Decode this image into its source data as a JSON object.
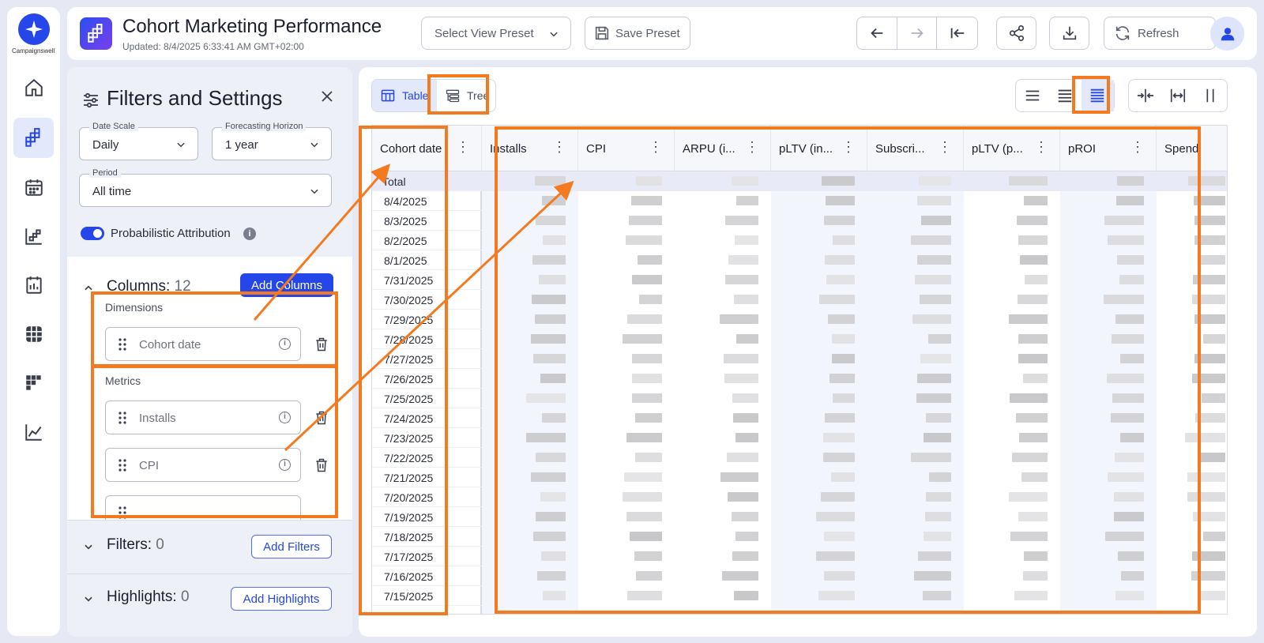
{
  "brand": {
    "name": "Campaignswell",
    "accent": "#2546e8",
    "annotation_color": "#f47a20"
  },
  "header": {
    "title": "Cohort Marketing Performance",
    "updated": "Updated: 8/4/2025 6:33:41 AM GMT+02:00",
    "preset_select_label": "Select View Preset",
    "save_preset_label": "Save Preset",
    "refresh_label": "Refresh"
  },
  "sidebar": {
    "items": [
      {
        "name": "home-icon"
      },
      {
        "name": "cohort-icon",
        "active": true
      },
      {
        "name": "calendar-icon"
      },
      {
        "name": "funnel-icon"
      },
      {
        "name": "report-icon"
      },
      {
        "name": "grid-icon"
      },
      {
        "name": "heatmap-icon"
      },
      {
        "name": "chart-icon"
      }
    ]
  },
  "filters_panel": {
    "title": "Filters and Settings",
    "date_scale": {
      "label": "Date Scale",
      "value": "Daily"
    },
    "forecasting_horizon": {
      "label": "Forecasting Horizon",
      "value": "1 year"
    },
    "period": {
      "label": "Period",
      "value": "All time"
    },
    "probabilistic_attribution": {
      "label": "Probabilistic Attribution",
      "enabled": true
    },
    "columns": {
      "title": "Columns:",
      "count": "12",
      "add_label": "Add Columns",
      "dimensions_label": "Dimensions",
      "dimensions": [
        "Cohort date"
      ],
      "metrics_label": "Metrics",
      "metrics": [
        "Installs",
        "CPI"
      ]
    },
    "filters": {
      "title": "Filters:",
      "count": "0",
      "add_label": "Add Filters"
    },
    "highlights": {
      "title": "Highlights:",
      "count": "0",
      "add_label": "Add Highlights"
    }
  },
  "view": {
    "tabs": [
      "Table",
      "Tree"
    ],
    "active_tab": "Table",
    "density_selected": "compact"
  },
  "table": {
    "headers": [
      "Cohort date",
      "Installs",
      "CPI",
      "ARPU (i...",
      "pLTV (in...",
      "Subscri...",
      "pLTV (p...",
      "pROI",
      "Spend"
    ],
    "total_label": "Total",
    "dates": [
      "8/4/2025",
      "8/3/2025",
      "8/2/2025",
      "8/1/2025",
      "7/31/2025",
      "7/30/2025",
      "7/29/2025",
      "7/28/2025",
      "7/27/2025",
      "7/26/2025",
      "7/25/2025",
      "7/24/2025",
      "7/23/2025",
      "7/22/2025",
      "7/21/2025",
      "7/20/2025",
      "7/19/2025",
      "7/18/2025",
      "7/17/2025",
      "7/16/2025",
      "7/15/2025"
    ]
  }
}
